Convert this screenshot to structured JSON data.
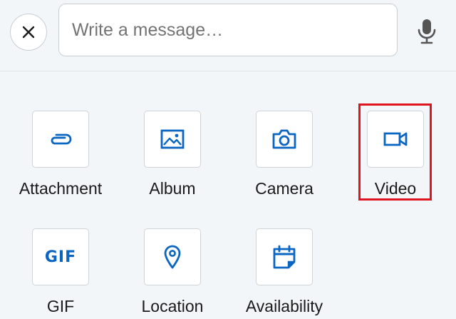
{
  "composer": {
    "close_icon": "close-icon",
    "message_placeholder": "Write a message…",
    "mic_icon": "microphone-icon"
  },
  "accent_color": "#0a66c2",
  "highlight_color": "#e0141e",
  "attachments": [
    {
      "label": "Attachment",
      "icon": "paperclip-icon"
    },
    {
      "label": "Album",
      "icon": "image-icon"
    },
    {
      "label": "Camera",
      "icon": "camera-icon"
    },
    {
      "label": "Video",
      "icon": "video-camera-icon",
      "highlighted": true
    },
    {
      "label": "GIF",
      "icon": "gif-icon",
      "icon_text": "GIF"
    },
    {
      "label": "Location",
      "icon": "location-pin-icon"
    },
    {
      "label": "Availability",
      "icon": "calendar-icon"
    }
  ]
}
